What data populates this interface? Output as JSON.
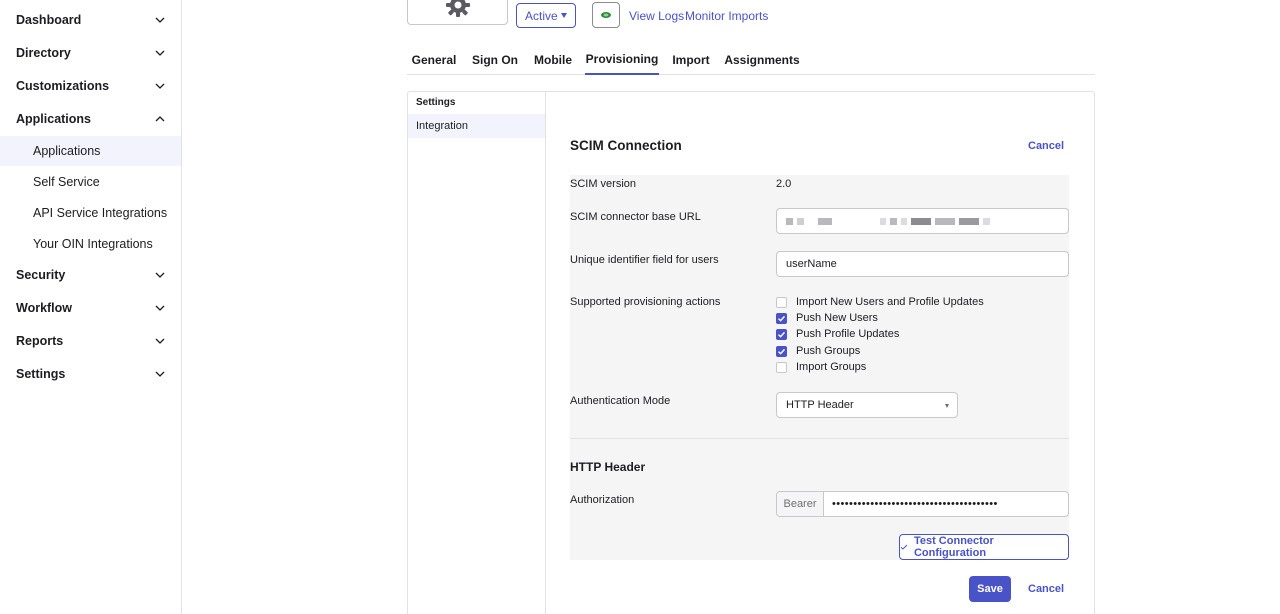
{
  "sidebar": {
    "sections": [
      {
        "label": "Dashboard",
        "expanded": false
      },
      {
        "label": "Directory",
        "expanded": false
      },
      {
        "label": "Customizations",
        "expanded": false
      },
      {
        "label": "Applications",
        "expanded": true
      },
      {
        "label": "Security",
        "expanded": false
      },
      {
        "label": "Workflow",
        "expanded": false
      },
      {
        "label": "Reports",
        "expanded": false
      },
      {
        "label": "Settings",
        "expanded": false
      }
    ],
    "applications_items": [
      {
        "label": "Applications",
        "active": true
      },
      {
        "label": "Self Service",
        "active": false
      },
      {
        "label": "API Service Integrations",
        "active": false
      },
      {
        "label": "Your OIN Integrations",
        "active": false
      }
    ]
  },
  "header": {
    "status_value": "Active",
    "links": [
      "View Logs",
      "Monitor Imports"
    ]
  },
  "tabs": [
    {
      "label": "General",
      "active": false
    },
    {
      "label": "Sign On",
      "active": false
    },
    {
      "label": "Mobile",
      "active": false
    },
    {
      "label": "Provisioning",
      "active": true
    },
    {
      "label": "Import",
      "active": false
    },
    {
      "label": "Assignments",
      "active": false
    }
  ],
  "settings_nav": {
    "title": "Settings",
    "items": [
      {
        "label": "Integration",
        "active": true
      }
    ]
  },
  "scim": {
    "heading": "SCIM Connection",
    "cancel_label": "Cancel",
    "version_label": "SCIM version",
    "version_value": "2.0",
    "base_url_label": "SCIM connector base URL",
    "base_url_value_obscured": true,
    "unique_id_label": "Unique identifier field for users",
    "unique_id_value": "userName",
    "actions_label": "Supported provisioning actions",
    "actions": [
      {
        "label": "Import New Users and Profile Updates",
        "checked": false
      },
      {
        "label": "Push New Users",
        "checked": true
      },
      {
        "label": "Push Profile Updates",
        "checked": true
      },
      {
        "label": "Push Groups",
        "checked": true
      },
      {
        "label": "Import Groups",
        "checked": false
      }
    ],
    "auth_mode_label": "Authentication Mode",
    "auth_mode_value": "HTTP Header"
  },
  "http_header": {
    "heading": "HTTP Header",
    "authorization_label": "Authorization",
    "auth_prefix": "Bearer",
    "auth_value_masked": "•••••••••••••••••••••••••••••••••••••••"
  },
  "footer": {
    "test_button_label": "Test Connector Configuration",
    "save_label": "Save",
    "cancel_label": "Cancel"
  },
  "colors": {
    "accent": "#4a52c7",
    "active_bg": "#f2f3fd",
    "form_bg": "#f5f5f6",
    "border": "#e1e1e6"
  },
  "icons": {
    "app_logo": "gear-icon",
    "chevron": "chevron-down-icon",
    "app_icon_button": "app-icon",
    "check": "checkmark-icon"
  }
}
